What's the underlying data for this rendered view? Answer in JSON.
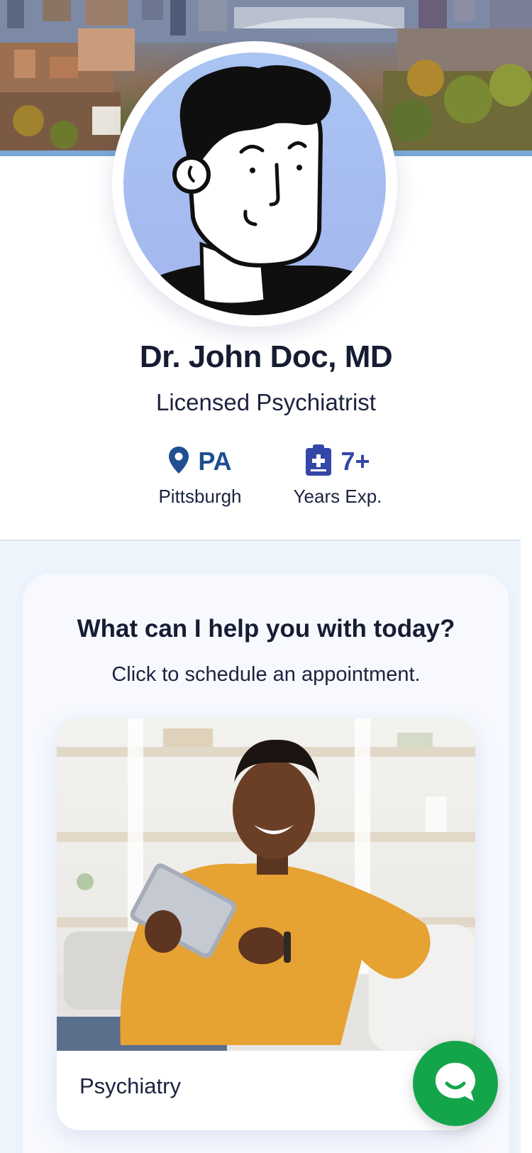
{
  "doctor": {
    "name": "Dr. John Doc, MD",
    "title": "Licensed Psychiatrist"
  },
  "stats": {
    "location": {
      "value": "PA",
      "label": "Pittsburgh",
      "icon": "map-pin-icon"
    },
    "experience": {
      "value": "7+",
      "label": "Years Exp.",
      "icon": "clipboard-medical-icon"
    }
  },
  "services": {
    "heading": "What can I help you with today?",
    "subheading": "Click to schedule an appointment.",
    "items": [
      {
        "label": "Psychiatry"
      }
    ]
  },
  "chat": {
    "icon": "chat-bubble-icon"
  },
  "colors": {
    "accent_blue": "#1f4f91",
    "accent_indigo": "#3447a8",
    "chat_green": "#14a54b",
    "section_bg": "#eef5fd"
  }
}
